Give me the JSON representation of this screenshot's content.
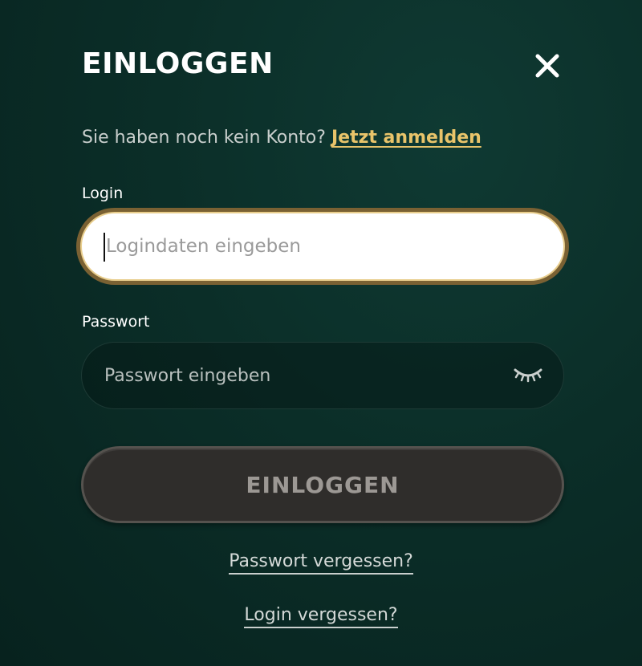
{
  "dialog": {
    "title": "EINLOGGEN",
    "close_icon": "close-icon"
  },
  "signup": {
    "prompt": "Sie haben noch kein Konto?",
    "link_label": "Jetzt anmelden",
    "link_color": "#e9c46a"
  },
  "login": {
    "label": "Login",
    "value": "",
    "placeholder": "Logindaten eingeben",
    "focus_border_color": "#7a6133"
  },
  "password": {
    "label": "Passwort",
    "value": "",
    "placeholder": "Passwort eingeben",
    "visibility_icon": "eye-closed-icon"
  },
  "submit": {
    "label": "EINLOGGEN",
    "state": "disabled"
  },
  "links": {
    "forgot_password": "Passwort vergessen?",
    "forgot_login": "Login vergessen?"
  },
  "colors": {
    "background": "#0b2e28",
    "accent": "#e9c46a",
    "button_bg": "#2f2d2b"
  }
}
